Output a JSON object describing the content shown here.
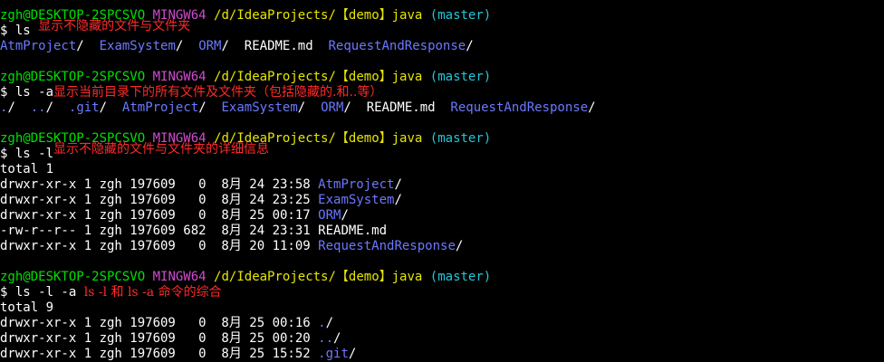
{
  "colors": {
    "background": "#000000",
    "user_host": "#00e000",
    "mingw": "#d04cd0",
    "path": "#e6e600",
    "branch": "#22c7d8",
    "directory": "#6b78ff",
    "text": "#ffffff",
    "annotation": "#ff2a2a"
  },
  "prompt": {
    "user_host": "zgh@DESKTOP-2SPCSVO",
    "env": "MINGW64",
    "path": "/d/IdeaProjects/【demo】java",
    "branch": "(master)"
  },
  "blocks": [
    {
      "command": "$ ls",
      "note": "显示不隐藏的文件与文件夹",
      "output_inline": [
        {
          "text": "AtmProject",
          "type": "dir"
        },
        {
          "text": "ExamSystem",
          "type": "dir"
        },
        {
          "text": "ORM",
          "type": "dir"
        },
        {
          "text": "README.md",
          "type": "file"
        },
        {
          "text": "RequestAndResponse",
          "type": "dir"
        }
      ]
    },
    {
      "command": "$ ls -a",
      "note": "显示当前目录下的所有文件及文件夹（包括隐藏的.和..等）",
      "output_inline": [
        {
          "text": ".",
          "type": "dir"
        },
        {
          "text": "..",
          "type": "dir"
        },
        {
          "text": ".git",
          "type": "dir"
        },
        {
          "text": "AtmProject",
          "type": "dir"
        },
        {
          "text": "ExamSystem",
          "type": "dir"
        },
        {
          "text": "ORM",
          "type": "dir"
        },
        {
          "text": "README.md",
          "type": "file"
        },
        {
          "text": "RequestAndResponse",
          "type": "dir"
        }
      ]
    },
    {
      "command": "$ ls -l",
      "note": "显示不隐藏的文件与文件夹的详细信息",
      "total": "total 1",
      "rows": [
        {
          "meta": "drwxr-xr-x 1 zgh 197609   0  8月 24 23:58 ",
          "name": "AtmProject",
          "type": "dir"
        },
        {
          "meta": "drwxr-xr-x 1 zgh 197609   0  8月 24 23:25 ",
          "name": "ExamSystem",
          "type": "dir"
        },
        {
          "meta": "drwxr-xr-x 1 zgh 197609   0  8月 25 00:17 ",
          "name": "ORM",
          "type": "dir"
        },
        {
          "meta": "-rw-r--r-- 1 zgh 197609 682  8月 24 23:31 ",
          "name": "README.md",
          "type": "file"
        },
        {
          "meta": "drwxr-xr-x 1 zgh 197609   0  8月 20 11:09 ",
          "name": "RequestAndResponse",
          "type": "dir"
        }
      ]
    },
    {
      "command": "$ ls -l -a",
      "note": "ls -l 和 ls -a 命令的综合",
      "total": "total 9",
      "rows": [
        {
          "meta": "drwxr-xr-x 1 zgh 197609   0  8月 25 00:16 ",
          "name": ".",
          "type": "dir"
        },
        {
          "meta": "drwxr-xr-x 1 zgh 197609   0  8月 25 00:20 ",
          "name": "..",
          "type": "dir"
        },
        {
          "meta": "drwxr-xr-x 1 zgh 197609   0  8月 25 15:52 ",
          "name": ".git",
          "type": "dir"
        }
      ]
    }
  ]
}
